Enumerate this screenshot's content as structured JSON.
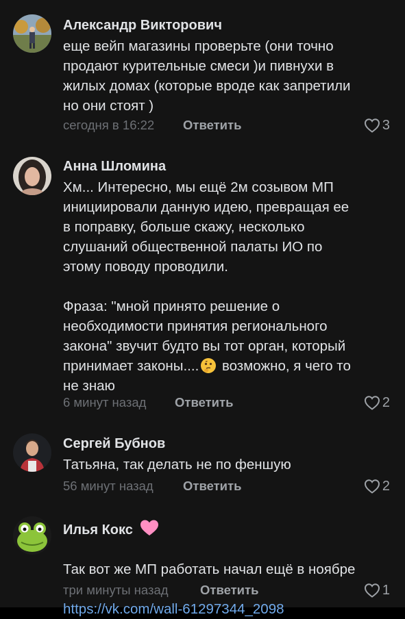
{
  "comments": [
    {
      "author": "Александр Викторович",
      "text": "еще вейп магазины проверьте (они точно\nпродают курительные смеси )и пивнухи в\nжилых домах (которые вроде как запретили\nно они стоят )",
      "time": "сегодня в 16:22",
      "reply_label": "Ответить",
      "likes": "3"
    },
    {
      "author": "Анна Шломина",
      "text_part1": "Хм... Интересно, мы ещё 2м созывом МП\nинициировали данную идею, превращая ее\nв поправку, больше скажу, несколько\nслушаний общественной палаты ИО по\nэтому поводу проводили.\n\nФраза: \"мной принято решение о\nнеобходимости принятия регионального\nзакона\" звучит будто вы тот орган, который\nпринимает законы....",
      "text_part2": " возможно, я чего то\nне знаю",
      "time": "6 минут назад",
      "reply_label": "Ответить",
      "likes": "2"
    },
    {
      "author": "Сергей Бубнов",
      "text": "Татьяна, так делать не по феншую",
      "time": "56 минут назад",
      "reply_label": "Ответить",
      "likes": "2"
    },
    {
      "author": "Илья Кокс",
      "text": "Так вот же МП работать начал ещё в ноябре",
      "link": "https://vk.com/wall-61297344_2098",
      "time": "три минуты назад",
      "reply_label": "Ответить",
      "likes": "1"
    }
  ],
  "icons": {
    "like": "heart-outline-icon",
    "emoji": "thinking-face-emoji",
    "author_badge": "pink-heart-icon"
  },
  "colors": {
    "background": "#141414",
    "text": "#e1e3e6",
    "secondary": "#6d7075",
    "action": "#9fa3a8",
    "link": "#71aaeb",
    "badge": "#ff8fc3"
  }
}
